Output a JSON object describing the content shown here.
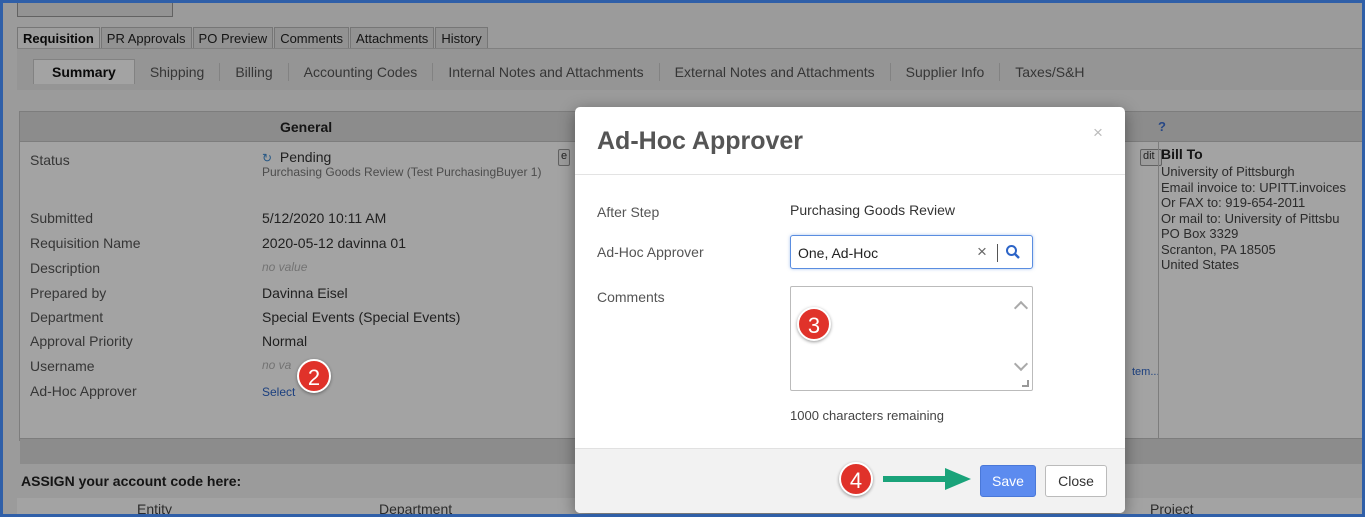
{
  "tabs_primary": [
    "Requisition",
    "PR Approvals",
    "PO Preview",
    "Comments",
    "Attachments",
    "History"
  ],
  "tabs_secondary": [
    "Summary",
    "Shipping",
    "Billing",
    "Accounting Codes",
    "Internal Notes and Attachments",
    "External Notes and Attachments",
    "Supplier Info",
    "Taxes/S&H"
  ],
  "general": {
    "title": "General",
    "status_label": "Status",
    "status_value": "Pending",
    "status_sub": "Purchasing Goods Review (Test PurchasingBuyer 1)",
    "submitted_label": "Submitted",
    "submitted_value": "5/12/2020 10:11 AM",
    "reqname_label": "Requisition Name",
    "reqname_value": "2020-05-12 davinna 01",
    "description_label": "Description",
    "description_value": "no value",
    "prepared_label": "Prepared by",
    "prepared_value": "Davinna Eisel",
    "department_label": "Department",
    "department_value": "Special Events (Special Events)",
    "priority_label": "Approval Priority",
    "priority_value": "Normal",
    "username_label": "Username",
    "username_value": "no va",
    "adhoc_label": "Ad-Hoc Approver",
    "adhoc_value": "Select",
    "edit_left": "e",
    "edit_right": "dit",
    "question": "?",
    "item_link": "tem..."
  },
  "bill_to": {
    "title": "Bill To",
    "lines": [
      "University of Pittsburgh",
      "Email invoice to: UPITT.invoices",
      "Or FAX to: 919-654-2011",
      "Or mail to: University of Pittsbu",
      "PO Box 3329",
      "Scranton, PA 18505",
      "United States"
    ]
  },
  "account": {
    "assign_text": "ASSIGN your account code here:",
    "columns": [
      "Entity",
      "Department",
      "Project"
    ]
  },
  "modal": {
    "title": "Ad-Hoc Approver",
    "close_glyph": "×",
    "after_step_label": "After Step",
    "after_step_value": "Purchasing Goods Review",
    "approver_label": "Ad-Hoc Approver",
    "approver_value": "One, Ad-Hoc",
    "clear_glyph": "×",
    "comments_label": "Comments",
    "remaining": "1000 characters remaining",
    "save_label": "Save",
    "close_label": "Close"
  },
  "badges": [
    "2",
    "3",
    "4"
  ],
  "colors": {
    "badge": "#e0322a",
    "arrow": "#1aa37a",
    "save": "#5c8bef",
    "frame": "#2f5fa8"
  }
}
